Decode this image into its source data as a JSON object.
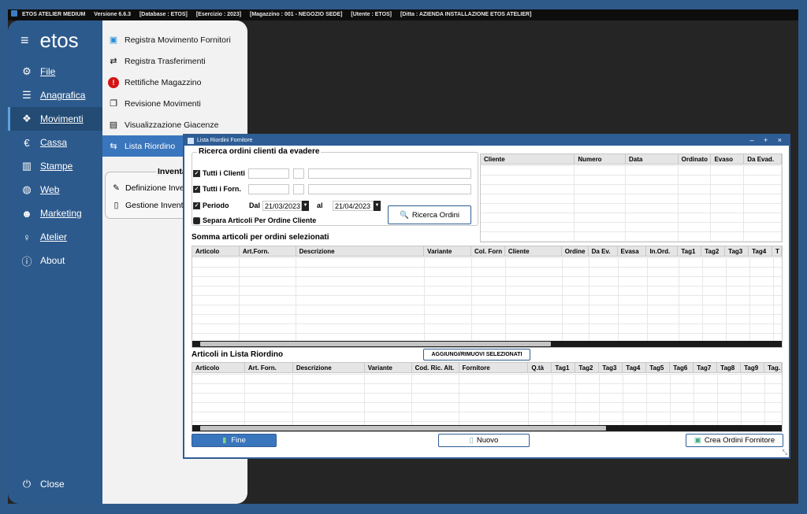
{
  "titlebar": {
    "app": "ETOS ATELIER MEDIUM",
    "version": "Versione 6.6.3",
    "database": "[Database : ETOS]",
    "esercizio": "[Esercizio : 2023]",
    "magazzino": "[Magazzino : 001 - NEGOZIO SEDE]",
    "utente": "[Utente : ETOS]",
    "ditta": "[Ditta : AZIENDA INSTALLAZIONE ETOS ATELIER]"
  },
  "sidebar": {
    "brand": "etos",
    "items": [
      {
        "label": "File",
        "icon": "gear-icon"
      },
      {
        "label": "Anagrafica",
        "icon": "database-icon"
      },
      {
        "label": "Movimenti",
        "icon": "boxes-icon"
      },
      {
        "label": "Cassa",
        "icon": "euro-icon"
      },
      {
        "label": "Stampe",
        "icon": "chart-icon"
      },
      {
        "label": "Web",
        "icon": "globe-icon"
      },
      {
        "label": "Marketing",
        "icon": "users-icon"
      },
      {
        "label": "Atelier",
        "icon": "person-icon"
      },
      {
        "label": "About",
        "icon": "info-icon"
      }
    ],
    "close": "Close"
  },
  "submenu": {
    "items": [
      {
        "label": "Registra Movimento Fornitori",
        "icon": "bag-icon"
      },
      {
        "label": "Registra Trasferimenti",
        "icon": "transfer-icon"
      },
      {
        "label": "Rettifiche Magazzino",
        "icon": "alert-icon"
      },
      {
        "label": "Revisione Movimenti",
        "icon": "copy-icon"
      },
      {
        "label": "Visualizzazione Giacenze",
        "icon": "archive-icon"
      },
      {
        "label": "Lista Riordino",
        "icon": "reorder-icon"
      }
    ],
    "inventory_title": "Inventa",
    "inventory_items": [
      {
        "label": "Definizione Inven",
        "icon": "pencil-icon"
      },
      {
        "label": "Gestione Inventa",
        "icon": "document-icon"
      }
    ]
  },
  "dialog": {
    "title": "Lista Riordini Fornitore",
    "controls": "– + ×",
    "search_legend": "Ricerca ordini clienti da evadere",
    "tutti_clienti": "Tutti i Clienti",
    "tutti_forn": "Tutti i Forn.",
    "periodo": "Periodo",
    "dal": "Dal",
    "al": "al",
    "date_from": "21/03/2023",
    "date_to": "21/04/2023",
    "separa": "Separa Articoli Per Ordine Cliente",
    "ricerca_btn": "Ricerca Ordini",
    "orders_columns": [
      "Cliente",
      "Numero",
      "Data",
      "Ordinato",
      "Evaso",
      "Da Evad."
    ],
    "sum_title": "Somma articoli per ordini selezionati",
    "sum_columns": [
      "Articolo",
      "Art.Forn.",
      "Descrizione",
      "Variante",
      "Col. Forn",
      "Cliente",
      "Ordine",
      "Da Ev.",
      "Evasa",
      "In.Ord.",
      "Tag1",
      "Tag2",
      "Tag3",
      "Tag4",
      "T"
    ],
    "list_title": "Articoli in Lista Riordino",
    "toggle_btn": "AGGIUNGI/RIMUOVI SELEZIONATI",
    "list_columns": [
      "Articolo",
      "Art. Forn.",
      "Descrizione",
      "Variante",
      "Cod. Ric. Alt.",
      "Fornitore",
      "Q.tà",
      "Tag1",
      "Tag2",
      "Tag3",
      "Tag4",
      "Tag5",
      "Tag6",
      "Tag7",
      "Tag8",
      "Tag9",
      "Tag."
    ],
    "fine_btn": "Fine",
    "nuovo_btn": "Nuovo",
    "crea_btn": "Crea Ordini Fornitore"
  },
  "colors": {
    "sidebar": "#2d5a8c",
    "accent": "#3a76bd",
    "dialog_border": "#2f5d94"
  }
}
